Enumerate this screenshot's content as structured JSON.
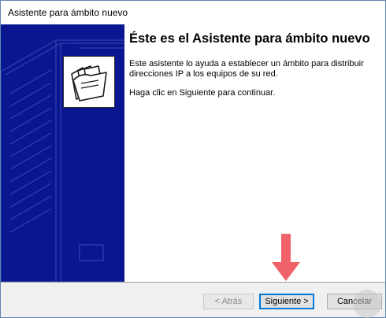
{
  "window": {
    "title": "Asistente para ámbito nuevo"
  },
  "content": {
    "heading": "Éste es el Asistente para ámbito nuevo",
    "description": "Este asistente lo ayuda a establecer un ámbito para distribuir direcciones IP a los equipos de su red.",
    "instruction": "Haga clic en Siguiente para continuar."
  },
  "buttons": {
    "back": "< Atrás",
    "next": "Siguiente >",
    "cancel": "Cancelar"
  },
  "icons": {
    "wizard": "folders-icon",
    "pointer": "down-arrow-icon"
  },
  "colors": {
    "side_panel": "#0a1590",
    "arrow": "#f0626a",
    "focus_border": "#0078d7"
  }
}
